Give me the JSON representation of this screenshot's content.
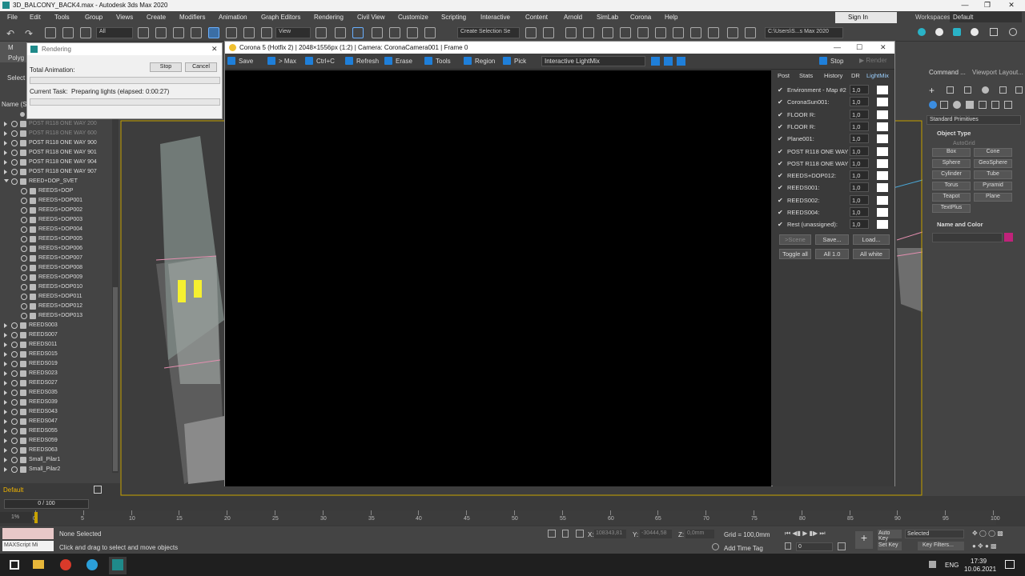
{
  "window": {
    "title": "3D_BALCONY_BACK4.max - Autodesk 3ds Max 2020"
  },
  "menu": [
    "File",
    "Edit",
    "Tools",
    "Group",
    "Views",
    "Create",
    "Modifiers",
    "Animation",
    "Graph Editors",
    "Rendering",
    "Civil View",
    "Customize",
    "Scripting",
    "Interactive",
    "Content",
    "Arnold",
    "SimLab",
    "Corona",
    "Help"
  ],
  "signin": "Sign In",
  "workspaces": {
    "label": "Workspaces:",
    "value": "Default"
  },
  "toolbar": {
    "filter": "All",
    "view": "View",
    "selection_set": "Create Selection Se",
    "path": "C:\\Users\\S...s Max 2020"
  },
  "left_tabs": {
    "modeling": "M",
    "poly": "Polyg",
    "select": "Select",
    "name_col": "Name (S"
  },
  "rendering_dialog": {
    "title": "Rendering",
    "total_animation": "Total Animation:",
    "stop": "Stop",
    "cancel": "Cancel",
    "current_task_label": "Current Task:",
    "current_task": "Preparing lights (elapsed: 0:00:27)"
  },
  "scene_items": [
    {
      "name": "POST R118 ONE WAY 200",
      "dim": true
    },
    {
      "name": "POST R118 ONE WAY 600",
      "dim": true
    },
    {
      "name": "POST R118 ONE WAY 900"
    },
    {
      "name": "POST R118 ONE WAY 901"
    },
    {
      "name": "POST R118 ONE WAY 904"
    },
    {
      "name": "POST R118 ONE WAY 907"
    },
    {
      "name": "REED+DOP_SVET",
      "open": true
    },
    {
      "name": "REEDS+DOP",
      "child": true
    },
    {
      "name": "REEDS+DOP001",
      "child": true
    },
    {
      "name": "REEDS+DOP002",
      "child": true
    },
    {
      "name": "REEDS+DOP003",
      "child": true
    },
    {
      "name": "REEDS+DOP004",
      "child": true
    },
    {
      "name": "REEDS+DOP005",
      "child": true
    },
    {
      "name": "REEDS+DOP006",
      "child": true
    },
    {
      "name": "REEDS+DOP007",
      "child": true
    },
    {
      "name": "REEDS+DOP008",
      "child": true
    },
    {
      "name": "REEDS+DOP009",
      "child": true
    },
    {
      "name": "REEDS+DOP010",
      "child": true
    },
    {
      "name": "REEDS+DOP011",
      "child": true
    },
    {
      "name": "REEDS+DOP012",
      "child": true
    },
    {
      "name": "REEDS+DOP013",
      "child": true
    },
    {
      "name": "REEDS003"
    },
    {
      "name": "REEDS007"
    },
    {
      "name": "REEDS011"
    },
    {
      "name": "REEDS015"
    },
    {
      "name": "REEDS019"
    },
    {
      "name": "REEDS023"
    },
    {
      "name": "REEDS027"
    },
    {
      "name": "REEDS035"
    },
    {
      "name": "REEDS039"
    },
    {
      "name": "REEDS043"
    },
    {
      "name": "REEDS047"
    },
    {
      "name": "REEDS055"
    },
    {
      "name": "REEDS059"
    },
    {
      "name": "REEDS063"
    },
    {
      "name": "Small_Pilar1"
    },
    {
      "name": "Small_Pilar2"
    }
  ],
  "layer": "Default",
  "vfb": {
    "title": "Corona 5 (Hotfix 2) | 2048×1556px (1:2) | Camera: CoronaCamera001 | Frame 0",
    "toolbar": [
      "Save",
      "> Max",
      "Ctrl+C",
      "Refresh",
      "Erase",
      "Tools",
      "Region",
      "Pick"
    ],
    "lightmix_mode": "Interactive LightMix",
    "stop": "Stop",
    "render": "Render",
    "tabs": [
      "Post",
      "Stats",
      "History",
      "DR",
      "LightMix"
    ],
    "lightmix": [
      {
        "name": "Environment - Map #2",
        "value": "1,0"
      },
      {
        "name": "CoronaSun001:",
        "value": "1,0"
      },
      {
        "name": "FLOOR R:",
        "value": "1,0"
      },
      {
        "name": "FLOOR R:",
        "value": "1,0"
      },
      {
        "name": "Plane001:",
        "value": "1,0"
      },
      {
        "name": "POST R118 ONE WAY",
        "value": "1,0"
      },
      {
        "name": "POST R118 ONE WAY",
        "value": "1,0"
      },
      {
        "name": "REEDS+DOP012:",
        "value": "1,0"
      },
      {
        "name": "REEDS001:",
        "value": "1,0"
      },
      {
        "name": "REEDS002:",
        "value": "1,0"
      },
      {
        "name": "REEDS004:",
        "value": "1,0"
      },
      {
        "name": "Rest (unassigned):",
        "value": "1,0"
      }
    ],
    "buttons": {
      "scene": ">Scene",
      "save": "Save...",
      "load": "Load...",
      "toggle": "Toggle all",
      "all1": "All 1.0",
      "allwhite": "All white"
    }
  },
  "command_panel": {
    "title": "Command ...",
    "viewport_layout": "Viewport Layout...",
    "category": "Standard Primitives",
    "object_type": "Object Type",
    "autogrid": "AutoGrid",
    "primitives": [
      "Box",
      "Cone",
      "Sphere",
      "GeoSphere",
      "Cylinder",
      "Tube",
      "Torus",
      "Pyramid",
      "Teapot",
      "Plane",
      "TextPlus"
    ],
    "name_color": "Name and Color"
  },
  "timeline": {
    "frame": "0 / 100",
    "ticks": [
      "0",
      "5",
      "10",
      "15",
      "20",
      "25",
      "30",
      "35",
      "40",
      "45",
      "50",
      "55",
      "60",
      "65",
      "70",
      "75",
      "80",
      "85",
      "90",
      "95",
      "100"
    ]
  },
  "status": {
    "maxscript": "MAXScript Mi",
    "selected": "None Selected",
    "hint": "Click and drag to select and move objects",
    "x_label": "X:",
    "x": "108343,81",
    "y_label": "Y:",
    "y": "-30444,58",
    "z_label": "Z:",
    "z": "0,0mm",
    "grid": "Grid = 100,0mm",
    "add_time_tag": "Add Time Tag",
    "auto_key": "Auto Key",
    "set_key": "Set Key",
    "selected_dd": "Selected",
    "key_filters": "Key Filters...",
    "frame_field": "0"
  },
  "taskbar": {
    "lang": "ENG",
    "time": "17:39",
    "date": "10.06.2021"
  },
  "colors": {
    "accent": "#1f7fd9",
    "viewport_frame": "#c8a200",
    "swatch": "#c0237a"
  }
}
